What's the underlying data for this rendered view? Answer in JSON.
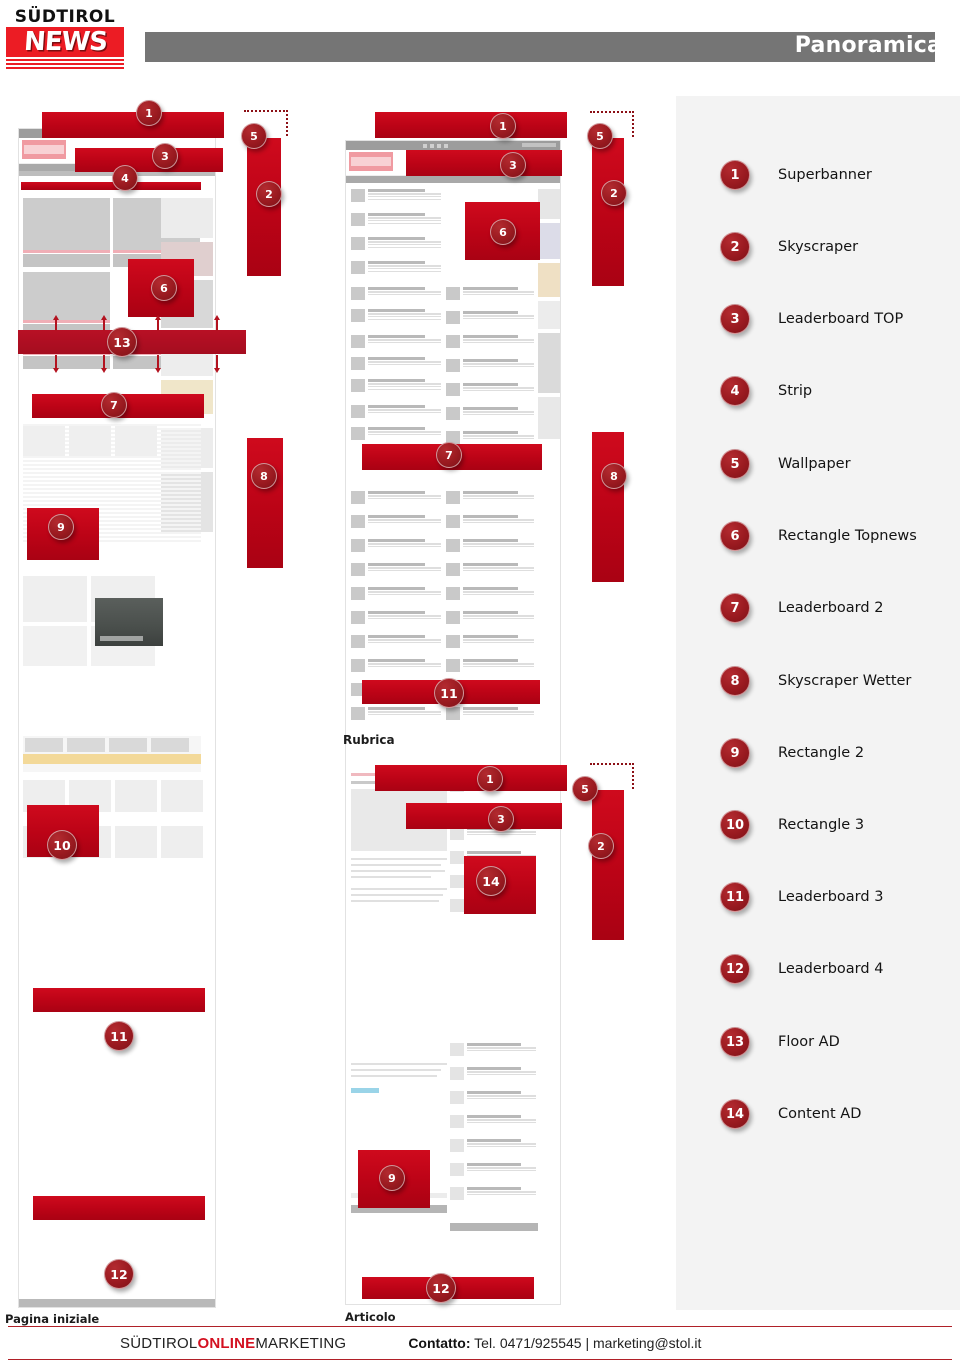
{
  "header": {
    "logo": {
      "top": "SÜDTIROL",
      "main": "NEWS"
    },
    "title": "Panoramica"
  },
  "legend": {
    "items": [
      {
        "num": "1",
        "label": "Superbanner"
      },
      {
        "num": "2",
        "label": "Skyscraper"
      },
      {
        "num": "3",
        "label": "Leaderboard TOP"
      },
      {
        "num": "4",
        "label": "Strip"
      },
      {
        "num": "5",
        "label": "Wallpaper"
      },
      {
        "num": "6",
        "label": "Rectangle Topnews"
      },
      {
        "num": "7",
        "label": "Leaderboard 2"
      },
      {
        "num": "8",
        "label": "Skyscraper Wetter"
      },
      {
        "num": "9",
        "label": "Rectangle 2"
      },
      {
        "num": "10",
        "label": "Rectangle 3"
      },
      {
        "num": "11",
        "label": "Leaderboard 3"
      },
      {
        "num": "12",
        "label": "Leaderboard 4"
      },
      {
        "num": "13",
        "label": "Floor AD"
      },
      {
        "num": "14",
        "label": "Content AD"
      }
    ]
  },
  "mockups": {
    "homepage": {
      "caption": "Pagina iniziale",
      "markers": [
        "1",
        "5",
        "3",
        "4",
        "2",
        "6",
        "13",
        "7",
        "8",
        "9",
        "10",
        "11",
        "12"
      ]
    },
    "article": {
      "caption": "Articolo",
      "markers": [
        "1",
        "5",
        "3",
        "2",
        "6",
        "7",
        "8",
        "11",
        "9",
        "12"
      ]
    },
    "rubrica": {
      "label": "Rubrica",
      "markers": [
        "1",
        "5",
        "3",
        "2",
        "14"
      ]
    }
  },
  "badges": {
    "hp_1": "1",
    "hp_5": "5",
    "hp_3": "3",
    "hp_4": "4",
    "hp_2": "2",
    "hp_6": "6",
    "hp_13": "13",
    "hp_7": "7",
    "hp_8": "8",
    "hp_9": "9",
    "hp_10": "10",
    "hp_11": "11",
    "hp_12": "12",
    "ar_1": "1",
    "ar_5": "5",
    "ar_3": "3",
    "ar_2": "2",
    "ar_6": "6",
    "ar_7": "7",
    "ar_8": "8",
    "ar_11": "11",
    "ar_9": "9",
    "ar_12": "12",
    "ru_1": "1",
    "ru_5": "5",
    "ru_3": "3",
    "ru_2": "2",
    "ru_14": "14"
  },
  "footer": {
    "brand_pre": "SÜDTIROL",
    "brand_mid": "ONLINE",
    "brand_post": "MARKETING",
    "contact_label": "Contatto:",
    "contact_value": "Tel. 0471/925545 | marketing@stol.it"
  },
  "colors": {
    "ad_red": "#c00418",
    "badge_red": "#9a1a20",
    "brand_red": "#ec1c24",
    "header_gray": "#757575",
    "panel_gray": "#f3f3f3"
  }
}
